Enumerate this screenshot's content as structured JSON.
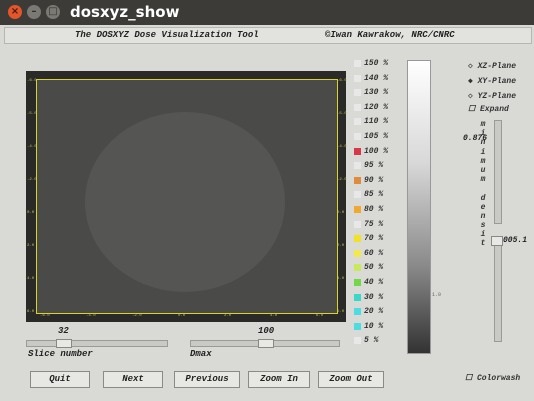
{
  "window": {
    "title": "dosxyz_show"
  },
  "banner": {
    "left": "The DOSXYZ Dose Visualization Tool",
    "right": "©Iwan Kawrakow, NRC/CNRC"
  },
  "plot": {
    "left_ticks": [
      "-6.0",
      "-5.0",
      "-4.0",
      "-2.0",
      "0.0",
      "2.0",
      "4.0",
      "6.0"
    ],
    "right_ticks": [
      "-6.0",
      "-5.0",
      "-4.0",
      "-2.0",
      "0.0",
      "2.0",
      "4.0",
      "6.0"
    ],
    "bottom_ticks": [
      "-6.0",
      "-4.0",
      "-2.0",
      "0.0",
      "2.0",
      "4.0",
      "6.0"
    ]
  },
  "slice": {
    "value": "32",
    "label": "Slice number"
  },
  "dmax": {
    "value": "100",
    "label": "Dmax"
  },
  "legend": {
    "items": [
      {
        "label": "150 %",
        "color": "#e8e8e8"
      },
      {
        "label": "140 %",
        "color": "#e8e8e8"
      },
      {
        "label": "130 %",
        "color": "#e8e8e8"
      },
      {
        "label": "120 %",
        "color": "#e8e8e8"
      },
      {
        "label": "110 %",
        "color": "#e8e8e8"
      },
      {
        "label": "105 %",
        "color": "#e8e8e8"
      },
      {
        "label": "100 %",
        "color": "#d8374a"
      },
      {
        "label": "95 %",
        "color": "#e8e8e8"
      },
      {
        "label": "90 %",
        "color": "#e08a3c"
      },
      {
        "label": "85 %",
        "color": "#e8e8e8"
      },
      {
        "label": "80 %",
        "color": "#f0a830"
      },
      {
        "label": "75 %",
        "color": "#e8e8e8"
      },
      {
        "label": "70 %",
        "color": "#f2e224"
      },
      {
        "label": "60 %",
        "color": "#f4e94a"
      },
      {
        "label": "50 %",
        "color": "#c8ea5a"
      },
      {
        "label": "40 %",
        "color": "#72d84a"
      },
      {
        "label": "30 %",
        "color": "#3ad8c8"
      },
      {
        "label": "20 %",
        "color": "#4cdde2"
      },
      {
        "label": "10 %",
        "color": "#4cdde2"
      },
      {
        "label": "5 %",
        "color": "#e8e8e8"
      }
    ],
    "scale_value": "1.0"
  },
  "planes": {
    "xz": "XZ-Plane",
    "xy": "XY-Plane",
    "yz": "YZ-Plane",
    "selected": "XY-Plane"
  },
  "expand": {
    "label": "Expand"
  },
  "density": {
    "min_value": "0.876",
    "min_label": "minimum density",
    "letters": [
      "m",
      "i",
      "n",
      "i",
      "m",
      "u",
      "m",
      "",
      "d",
      "e",
      "n",
      "s",
      "i",
      "t"
    ],
    "max_value": "005.1"
  },
  "buttons": {
    "quit": "Quit",
    "next": "Next",
    "previous": "Previous",
    "zoom_in": "Zoom In",
    "zoom_out": "Zoom Out"
  },
  "colorwash": {
    "label": "Colorwash"
  }
}
